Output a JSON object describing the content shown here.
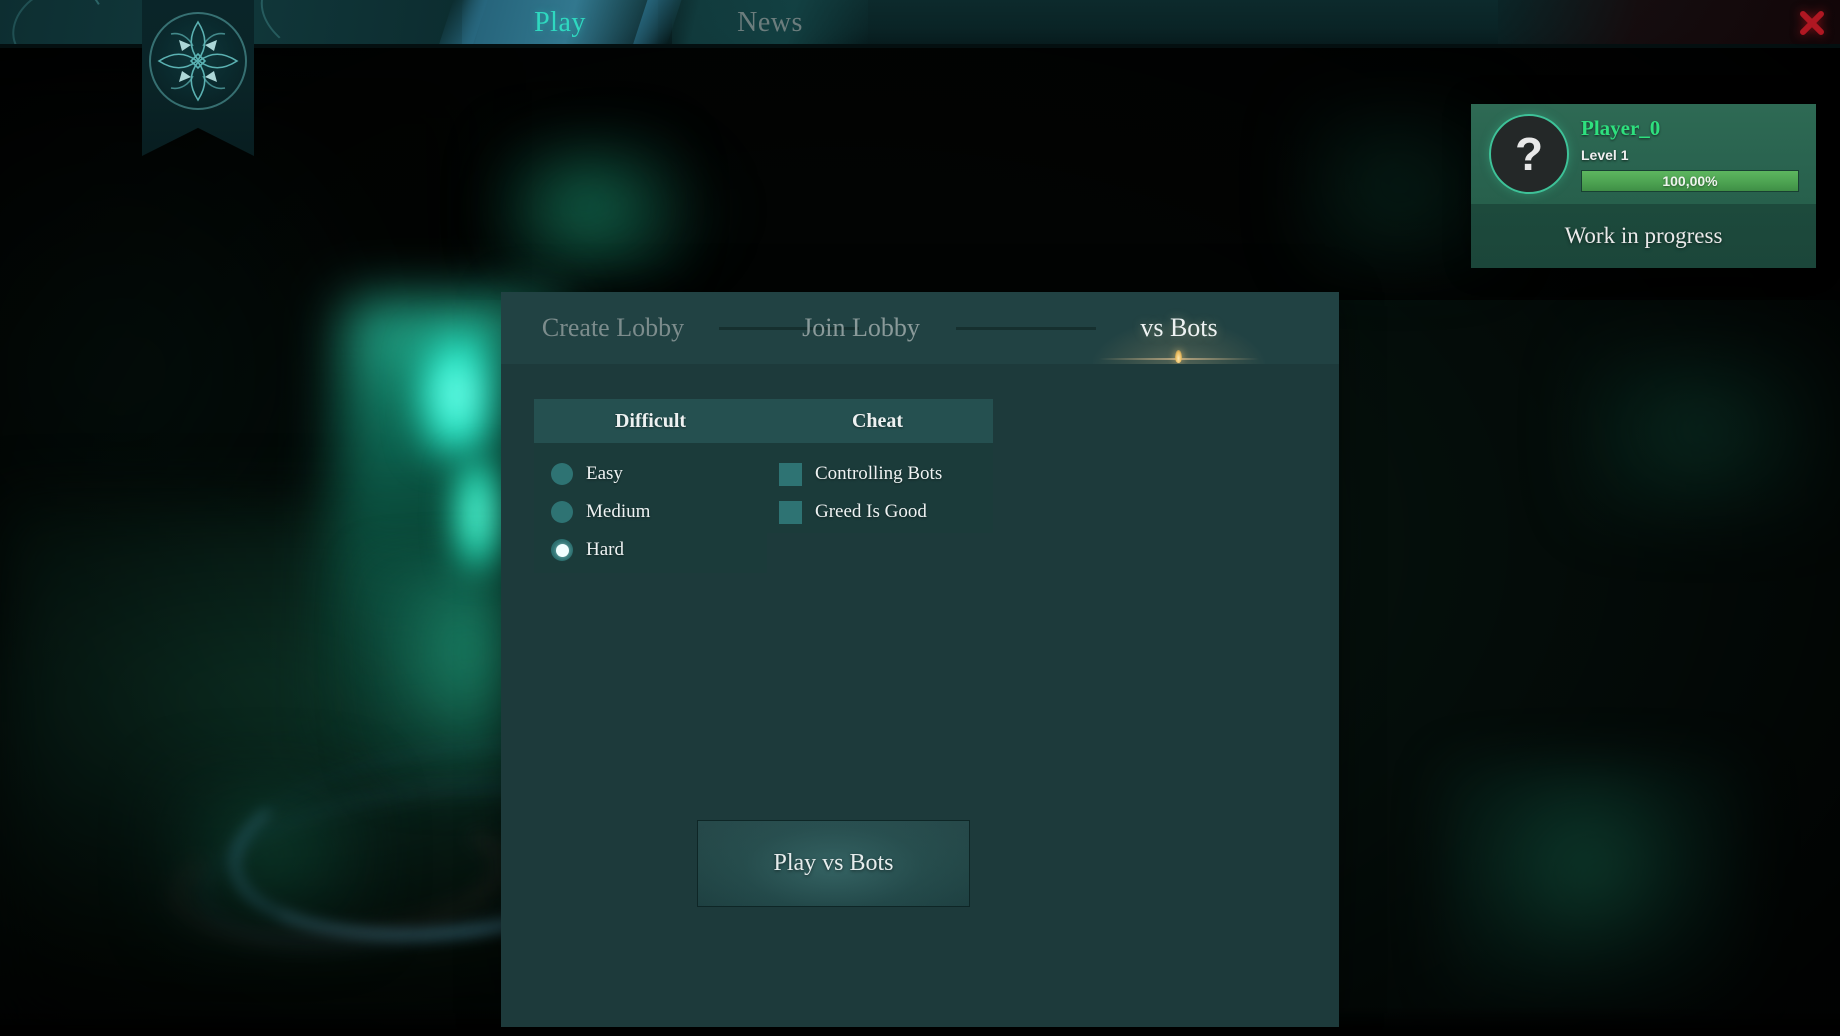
{
  "window": {
    "close_label": "×"
  },
  "topnav": {
    "tabs": [
      {
        "label": "Play",
        "active": true
      },
      {
        "label": "News",
        "active": false
      }
    ],
    "emblem_name": "game-emblem"
  },
  "player_card": {
    "avatar_glyph": "?",
    "name": "Player_0",
    "level": "Level 1",
    "xp_percent_label": "100,00%",
    "xp_percent_value": 100,
    "status": "Work in progress",
    "name_color": "#2ee07e",
    "xp_bar_color": "#4da352"
  },
  "panel": {
    "tabs": [
      {
        "label": "Create Lobby",
        "active": false
      },
      {
        "label": "Join Lobby",
        "active": false
      },
      {
        "label": "vs Bots",
        "active": true
      }
    ],
    "groups": [
      {
        "title": "Difficult",
        "type": "radio",
        "options": [
          {
            "label": "Easy",
            "selected": false
          },
          {
            "label": "Medium",
            "selected": false
          },
          {
            "label": "Hard",
            "selected": true
          }
        ]
      },
      {
        "title": "Cheat",
        "type": "checkbox",
        "options": [
          {
            "label": "Controlling Bots",
            "checked": false
          },
          {
            "label": "Greed Is Good",
            "checked": false
          }
        ]
      }
    ],
    "play_button": "Play vs Bots",
    "accent_color": "#2e7373",
    "active_tab_glow_color": "#d8ba8c"
  }
}
